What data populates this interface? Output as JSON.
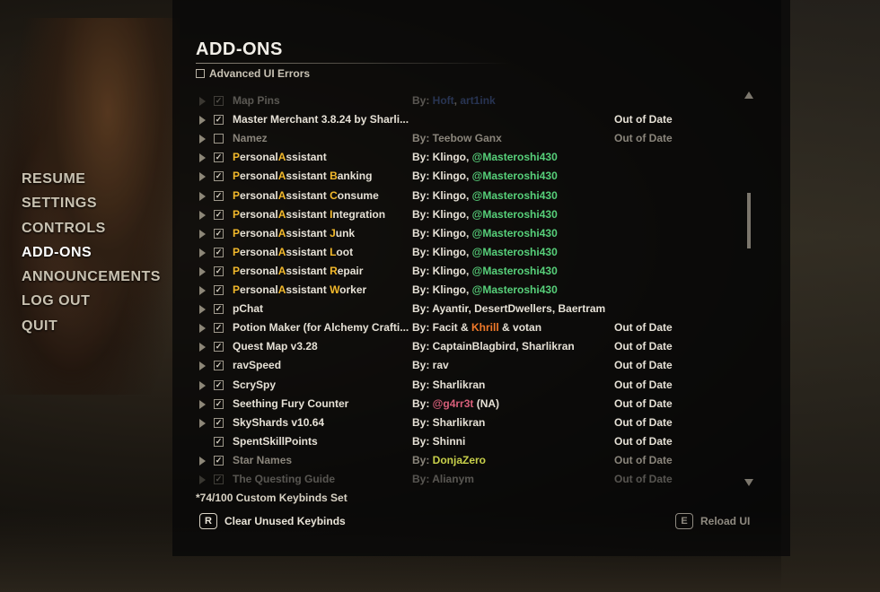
{
  "main_menu": [
    "RESUME",
    "SETTINGS",
    "CONTROLS",
    "ADD-ONS",
    "ANNOUNCEMENTS",
    "LOG OUT",
    "QUIT"
  ],
  "active_menu_index": 3,
  "panel": {
    "title": "ADD-ONS",
    "advanced_ui_errors_label": "Advanced UI Errors",
    "footer_keybinds": "*74/100 Custom Keybinds Set",
    "clear_key": "R",
    "clear_label": "Clear Unused Keybinds",
    "reload_key": "E",
    "reload_label": "Reload UI"
  },
  "addons": [
    {
      "name": [
        [
          "Map Pins",
          ""
        ]
      ],
      "author": [
        [
          "By: ",
          ""
        ],
        [
          "Hoft",
          "blue"
        ],
        [
          ", ",
          ""
        ],
        [
          "art1ink",
          "blue"
        ]
      ],
      "status": "",
      "checked": true,
      "expand": true,
      "style": "faded"
    },
    {
      "name": [
        [
          "Master Merchant 3.8.24 by Sharli...",
          ""
        ]
      ],
      "author": [],
      "status": "Out of Date",
      "checked": true,
      "expand": true,
      "style": ""
    },
    {
      "name": [
        [
          "Namez",
          ""
        ]
      ],
      "author": [
        [
          "By: Teebow Ganx",
          ""
        ]
      ],
      "status": "Out of Date",
      "checked": false,
      "expand": true,
      "style": "dim"
    },
    {
      "name": [
        [
          "P",
          "hl"
        ],
        [
          "ersonal",
          ""
        ],
        [
          "A",
          "hl"
        ],
        [
          "ssistant",
          ""
        ]
      ],
      "author": [
        [
          "By: Klingo, ",
          ""
        ],
        [
          "@Masteroshi430",
          "green"
        ]
      ],
      "status": "",
      "checked": true,
      "expand": true,
      "style": ""
    },
    {
      "name": [
        [
          "P",
          "hl"
        ],
        [
          "ersonal",
          ""
        ],
        [
          "A",
          "hl"
        ],
        [
          "ssistant ",
          ""
        ],
        [
          "B",
          "hl"
        ],
        [
          "anking",
          ""
        ]
      ],
      "author": [
        [
          "By: Klingo, ",
          ""
        ],
        [
          "@Masteroshi430",
          "green"
        ]
      ],
      "status": "",
      "checked": true,
      "expand": true,
      "style": ""
    },
    {
      "name": [
        [
          "P",
          "hl"
        ],
        [
          "ersonal",
          ""
        ],
        [
          "A",
          "hl"
        ],
        [
          "ssistant ",
          ""
        ],
        [
          "C",
          "hl"
        ],
        [
          "onsume",
          ""
        ]
      ],
      "author": [
        [
          "By: Klingo, ",
          ""
        ],
        [
          "@Masteroshi430",
          "green"
        ]
      ],
      "status": "",
      "checked": true,
      "expand": true,
      "style": ""
    },
    {
      "name": [
        [
          "P",
          "hl"
        ],
        [
          "ersonal",
          ""
        ],
        [
          "A",
          "hl"
        ],
        [
          "ssistant ",
          ""
        ],
        [
          "I",
          "hl"
        ],
        [
          "ntegration",
          ""
        ]
      ],
      "author": [
        [
          "By: Klingo, ",
          ""
        ],
        [
          "@Masteroshi430",
          "green"
        ]
      ],
      "status": "",
      "checked": true,
      "expand": true,
      "style": ""
    },
    {
      "name": [
        [
          "P",
          "hl"
        ],
        [
          "ersonal",
          ""
        ],
        [
          "A",
          "hl"
        ],
        [
          "ssistant ",
          ""
        ],
        [
          "J",
          "hl"
        ],
        [
          "unk",
          ""
        ]
      ],
      "author": [
        [
          "By: Klingo, ",
          ""
        ],
        [
          "@Masteroshi430",
          "green"
        ]
      ],
      "status": "",
      "checked": true,
      "expand": true,
      "style": ""
    },
    {
      "name": [
        [
          "P",
          "hl"
        ],
        [
          "ersonal",
          ""
        ],
        [
          "A",
          "hl"
        ],
        [
          "ssistant ",
          ""
        ],
        [
          "L",
          "hl"
        ],
        [
          "oot",
          ""
        ]
      ],
      "author": [
        [
          "By: Klingo, ",
          ""
        ],
        [
          "@Masteroshi430",
          "green"
        ]
      ],
      "status": "",
      "checked": true,
      "expand": true,
      "style": ""
    },
    {
      "name": [
        [
          "P",
          "hl"
        ],
        [
          "ersonal",
          ""
        ],
        [
          "A",
          "hl"
        ],
        [
          "ssistant ",
          ""
        ],
        [
          "R",
          "hl"
        ],
        [
          "epair",
          ""
        ]
      ],
      "author": [
        [
          "By: Klingo, ",
          ""
        ],
        [
          "@Masteroshi430",
          "green"
        ]
      ],
      "status": "",
      "checked": true,
      "expand": true,
      "style": ""
    },
    {
      "name": [
        [
          "P",
          "hl"
        ],
        [
          "ersonal",
          ""
        ],
        [
          "A",
          "hl"
        ],
        [
          "ssistant ",
          ""
        ],
        [
          "W",
          "hl"
        ],
        [
          "orker",
          ""
        ]
      ],
      "author": [
        [
          "By: Klingo, ",
          ""
        ],
        [
          "@Masteroshi430",
          "green"
        ]
      ],
      "status": "",
      "checked": true,
      "expand": true,
      "style": ""
    },
    {
      "name": [
        [
          "pChat",
          ""
        ]
      ],
      "author": [
        [
          "By: Ayantir, DesertDwellers, Baertram",
          ""
        ]
      ],
      "status": "",
      "checked": true,
      "expand": true,
      "style": ""
    },
    {
      "name": [
        [
          "Potion Maker (for Alchemy Crafti...",
          ""
        ]
      ],
      "author": [
        [
          "By: Facit & ",
          ""
        ],
        [
          "Khrill",
          "orange"
        ],
        [
          " & votan",
          ""
        ]
      ],
      "status": "Out of Date",
      "checked": true,
      "expand": true,
      "style": ""
    },
    {
      "name": [
        [
          "Quest Map v3.28",
          ""
        ]
      ],
      "author": [
        [
          "By: CaptainBlagbird, Sharlikran",
          ""
        ]
      ],
      "status": "Out of Date",
      "checked": true,
      "expand": true,
      "style": ""
    },
    {
      "name": [
        [
          "ravSpeed",
          ""
        ]
      ],
      "author": [
        [
          "By: rav",
          ""
        ]
      ],
      "status": "Out of Date",
      "checked": true,
      "expand": true,
      "style": ""
    },
    {
      "name": [
        [
          "ScrySpy",
          ""
        ]
      ],
      "author": [
        [
          "By: Sharlikran",
          ""
        ]
      ],
      "status": "Out of Date",
      "checked": true,
      "expand": true,
      "style": ""
    },
    {
      "name": [
        [
          "Seething Fury Counter",
          ""
        ]
      ],
      "author": [
        [
          "By: ",
          ""
        ],
        [
          "@g4rr3t",
          "pink"
        ],
        [
          " (NA)",
          ""
        ]
      ],
      "status": "Out of Date",
      "checked": true,
      "expand": true,
      "style": ""
    },
    {
      "name": [
        [
          "SkyShards v10.64",
          ""
        ]
      ],
      "author": [
        [
          "By: Sharlikran",
          ""
        ]
      ],
      "status": "Out of Date",
      "checked": true,
      "expand": true,
      "style": ""
    },
    {
      "name": [
        [
          "SpentSkillPoints",
          ""
        ]
      ],
      "author": [
        [
          "By: Shinni",
          ""
        ]
      ],
      "status": "Out of Date",
      "checked": true,
      "expand": false,
      "style": ""
    },
    {
      "name": [
        [
          "Star Names",
          ""
        ]
      ],
      "author": [
        [
          "By: ",
          ""
        ],
        [
          "DonjaZero",
          "yellowgreen"
        ]
      ],
      "status": "Out of Date",
      "checked": true,
      "expand": true,
      "style": "dim"
    },
    {
      "name": [
        [
          "The Questing Guide",
          ""
        ]
      ],
      "author": [
        [
          "By: Alianym",
          ""
        ]
      ],
      "status": "Out of Date",
      "checked": true,
      "expand": true,
      "style": "faded"
    }
  ]
}
